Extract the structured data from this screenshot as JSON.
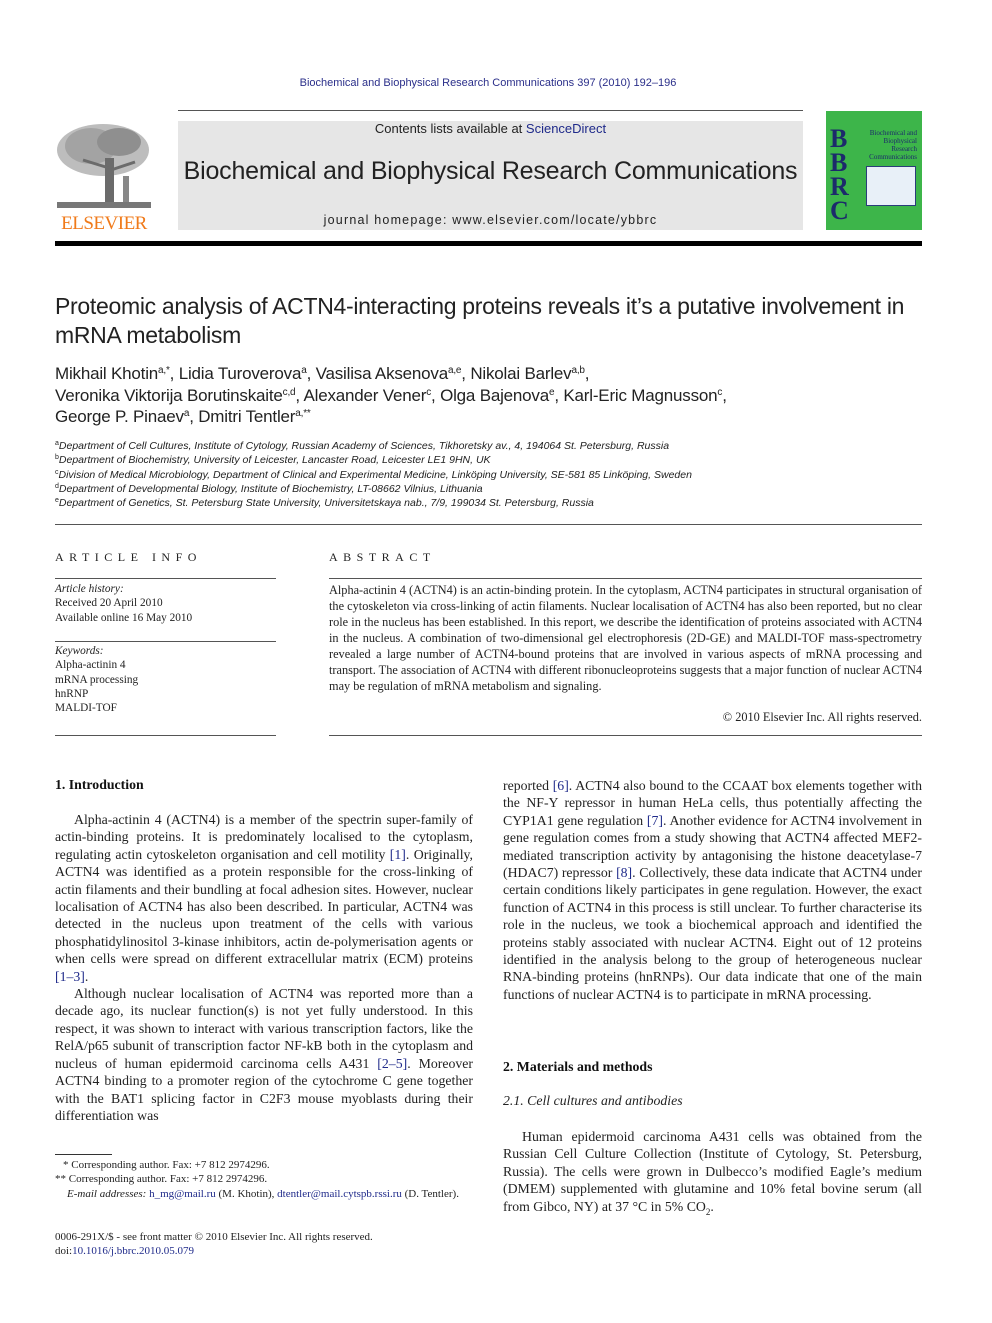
{
  "header": {
    "citation": "Biochemical and Biophysical Research Communications 397 (2010) 192–196",
    "contents_prefix": "Contents lists available at ",
    "contents_link": "ScienceDirect",
    "journal_name": "Biochemical and Biophysical Research Communications",
    "homepage_label": "journal homepage: ",
    "homepage_url": "www.elsevier.com/locate/ybbrc",
    "publisher_logo_text": "ELSEVIER",
    "cover": {
      "letters": [
        "B",
        "B",
        "R",
        "C"
      ],
      "title_lines": [
        "Biochemical and",
        "Biophysical",
        "Research",
        "Communications"
      ],
      "color": "#3db54a"
    },
    "brand_orange": "#f07a1a",
    "link_color": "#1f2a8a"
  },
  "article": {
    "title": "Proteomic analysis of ACTN4-interacting proteins reveals it’s a putative involvement in mRNA metabolism",
    "authors": [
      {
        "name": "Mikhail Khotin",
        "sup": "a,*"
      },
      {
        "name": "Lidia Turoverova",
        "sup": "a"
      },
      {
        "name": "Vasilisa Aksenova",
        "sup": "a,e"
      },
      {
        "name": "Nikolai Barlev",
        "sup": "a,b"
      },
      {
        "name": "Veronika Viktorija Borutinskaite",
        "sup": "c,d"
      },
      {
        "name": "Alexander Vener",
        "sup": "c"
      },
      {
        "name": "Olga Bajenova",
        "sup": "e"
      },
      {
        "name": "Karl-Eric Magnusson",
        "sup": "c"
      },
      {
        "name": "George P. Pinaev",
        "sup": "a"
      },
      {
        "name": "Dmitri Tentler",
        "sup": "a,**"
      }
    ],
    "affiliations": [
      {
        "key": "a",
        "text": "Department of Cell Cultures, Institute of Cytology, Russian Academy of Sciences, Tikhoretsky av., 4, 194064 St. Petersburg, Russia"
      },
      {
        "key": "b",
        "text": "Department of Biochemistry, University of Leicester, Lancaster Road, Leicester LE1 9HN, UK"
      },
      {
        "key": "c",
        "text": "Division of Medical Microbiology, Department of Clinical and Experimental Medicine, Linköping University, SE-581 85 Linköping, Sweden"
      },
      {
        "key": "d",
        "text": "Department of Developmental Biology, Institute of Biochemistry, LT-08662 Vilnius, Lithuania"
      },
      {
        "key": "e",
        "text": "Department of Genetics, St. Petersburg State University, Universitetskaya nab., 7/9, 199034 St. Petersburg, Russia"
      }
    ]
  },
  "article_info": {
    "heading": "ARTICLE INFO",
    "history_label": "Article history:",
    "received": "Received 20 April 2010",
    "available": "Available online 16 May 2010",
    "keywords_label": "Keywords:",
    "keywords": [
      "Alpha-actinin 4",
      "mRNA processing",
      "hnRNP",
      "MALDI-TOF"
    ]
  },
  "abstract": {
    "heading": "ABSTRACT",
    "text": "Alpha-actinin 4 (ACTN4) is an actin-binding protein. In the cytoplasm, ACTN4 participates in structural organisation of the cytoskeleton via cross-linking of actin filaments. Nuclear localisation of ACTN4 has also been reported, but no clear role in the nucleus has been established. In this report, we describe the identification of proteins associated with ACTN4 in the nucleus. A combination of two-dimensional gel electrophoresis (2D-GE) and MALDI-TOF mass-spectrometry revealed a large number of ACTN4-bound proteins that are involved in various aspects of mRNA processing and transport. The association of ACTN4 with different ribonucleoproteins suggests that a major function of nuclear ACTN4 may be regulation of mRNA metabolism and signaling.",
    "copyright": "© 2010 Elsevier Inc. All rights reserved."
  },
  "body": {
    "intro_heading": "1. Introduction",
    "intro_p1": [
      {
        "t": "Alpha-actinin 4 (ACTN4) is a member of the spectrin super-family of actin-binding proteins. It is predominately localised to the cytoplasm, regulating actin cytoskeleton organisation and cell motility "
      },
      {
        "ref": "[1]"
      },
      {
        "t": ". Originally, ACTN4 was identified as a protein responsible for the cross-linking of actin filaments and their bundling at focal adhesion sites. However, nuclear localisation of ACTN4 has also been described. In particular, ACTN4 was detected in the nucleus upon treatment of the cells with various phosphatidylinositol 3-kinase inhibitors, actin de-polymerisation agents or when cells were spread on different extracellular matrix (ECM) proteins "
      },
      {
        "ref": "[1–3]"
      },
      {
        "t": "."
      }
    ],
    "intro_p2": [
      {
        "t": "Although nuclear localisation of ACTN4 was reported more than a decade ago, its nuclear function(s) is not yet fully understood. In this respect, it was shown to interact with various transcription factors, like the RelA/p65 subunit of transcription factor NF-kB both in the cytoplasm and nucleus of human epidermoid carcinoma cells A431 "
      },
      {
        "ref": "[2–5]"
      },
      {
        "t": ". Moreover ACTN4 binding to a promoter region of the cytochrome C gene together with the BAT1 splicing factor in C2F3 mouse myoblasts during their differentiation was"
      }
    ],
    "intro_p2_cont": [
      {
        "t": "reported "
      },
      {
        "ref": "[6]"
      },
      {
        "t": ". ACTN4 also bound to the CCAAT box elements together with the NF-Y repressor in human HeLa cells, thus potentially affecting the CYP1A1 gene regulation "
      },
      {
        "ref": "[7]"
      },
      {
        "t": ". Another evidence for ACTN4 involvement in gene regulation comes from a study showing that ACTN4 affected MEF2-mediated transcription activity by antagonising the histone deacetylase-7 (HDAC7) repressor "
      },
      {
        "ref": "[8]"
      },
      {
        "t": ". Collectively, these data indicate that ACTN4 under certain conditions likely participates in gene regulation. However, the exact function of ACTN4 in this process is still unclear. To further characterise its role in the nucleus, we took a biochemical approach and identified the proteins stably associated with nuclear ACTN4. Eight out of 12 proteins identified in the analysis belong to the group of heterogeneous nuclear RNA-binding proteins (hnRNPs). Our data indicate that one of the main functions of nuclear ACTN4 is to participate in mRNA processing."
      }
    ],
    "methods_heading": "2. Materials and methods",
    "cells_subheading": "2.1. Cell cultures and antibodies",
    "cells_text_1": "Human epidermoid carcinoma A431 cells was obtained from the Russian Cell Culture Collection (Institute of Cytology, St. Petersburg, Russia). The cells were grown in Dulbecco’s modified Eagle’s medium (DMEM) supplemented with glutamine and 10% fetal bovine serum (all from Gibco, NY) at 37 °C in 5% CO",
    "cells_text_sub": "2",
    "cells_text_end": "."
  },
  "footnotes": {
    "fn1": "* Corresponding author. Fax: +7 812 2974296.",
    "fn2": "** Corresponding author. Fax: +7 812 2974296.",
    "email_label": "E-mail addresses:",
    "email1": "h_mg@mail.ru",
    "email1_owner": " (M. Khotin), ",
    "email2": "dtentler@mail.cytspb.rssi.ru",
    "email2_owner": " (D. Tentler).",
    "front_matter": "0006-291X/$ - see front matter © 2010 Elsevier Inc. All rights reserved.",
    "doi_label": "doi:",
    "doi": "10.1016/j.bbrc.2010.05.079"
  }
}
